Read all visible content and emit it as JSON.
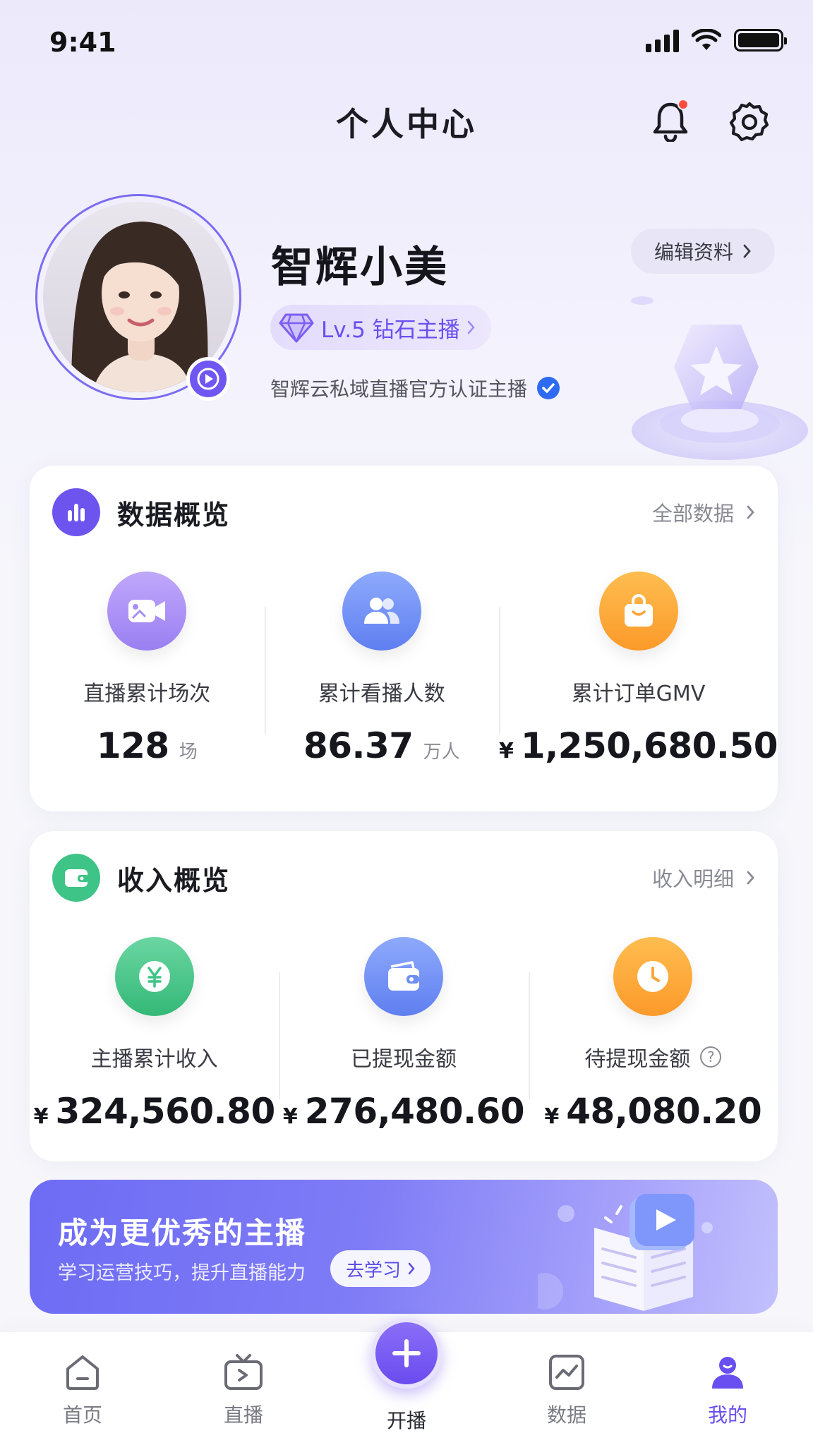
{
  "status_bar": {
    "time": "9:41"
  },
  "header": {
    "title": "个人中心"
  },
  "profile": {
    "name": "智辉小美",
    "level": "Lv.5 钻石主播",
    "verification": "智辉云私域直播官方认证主播",
    "edit_label": "编辑资料"
  },
  "data_overview": {
    "title": "数据概览",
    "link": "全部数据",
    "stats": [
      {
        "label": "直播累计场次",
        "value": "128",
        "unit": "场",
        "icon": "video-camera-icon",
        "color": "#a48bf3"
      },
      {
        "label": "累计看播人数",
        "value": "86.37",
        "unit": "万人",
        "icon": "users-icon",
        "color": "#6f8ff3"
      },
      {
        "label": "累计订单GMV",
        "currency": "¥",
        "value": "1,250,680.50",
        "icon": "shopping-bag-icon",
        "color": "#fba03a"
      }
    ]
  },
  "income_overview": {
    "title": "收入概览",
    "link": "收入明细",
    "stats": [
      {
        "label": "主播累计收入",
        "currency": "¥",
        "value": "324,560.80",
        "icon": "yen-coin-icon",
        "color": "#3ec486"
      },
      {
        "label": "已提现金额",
        "currency": "¥",
        "value": "276,480.60",
        "icon": "wallet-icon",
        "color": "#6f8ff3"
      },
      {
        "label": "待提现金额",
        "currency": "¥",
        "value": "48,080.20",
        "icon": "clock-icon",
        "color": "#fba03a"
      }
    ]
  },
  "banner": {
    "title": "成为更优秀的主播",
    "subtitle": "学习运营技巧，提升直播能力",
    "button": "去学习"
  },
  "tabbar": {
    "items": [
      {
        "label": "首页",
        "icon": "home-icon"
      },
      {
        "label": "直播",
        "icon": "tv-icon"
      },
      {
        "label": "开播",
        "icon": "plus-icon"
      },
      {
        "label": "数据",
        "icon": "chart-icon"
      },
      {
        "label": "我的",
        "icon": "user-icon"
      }
    ],
    "active": "我的",
    "accent": "#6a4ff0"
  }
}
